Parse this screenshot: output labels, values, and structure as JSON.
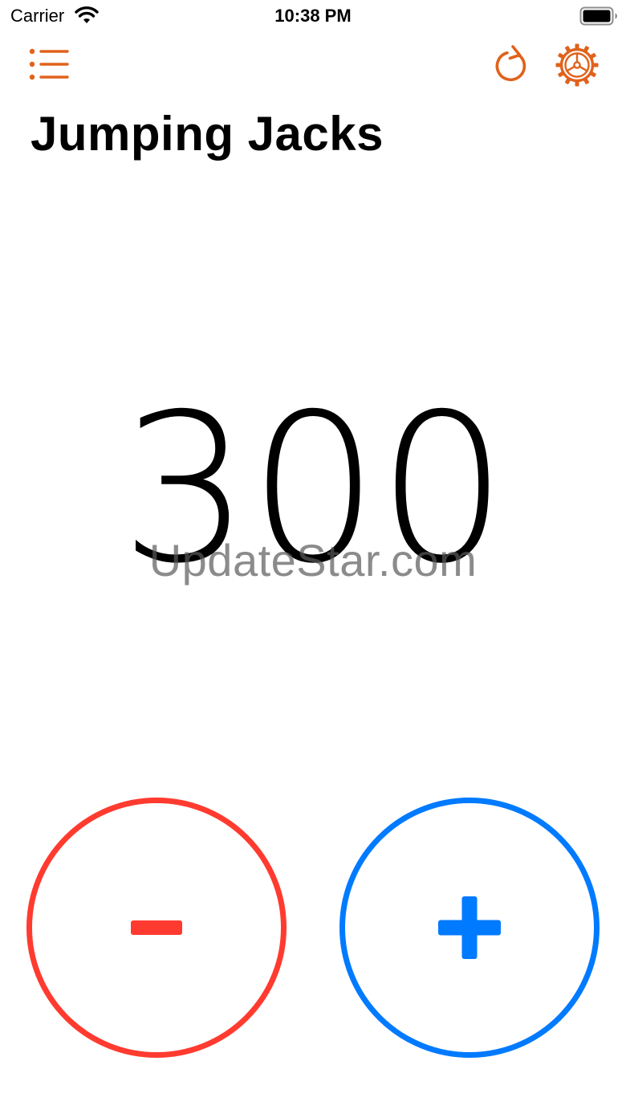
{
  "status_bar": {
    "carrier": "Carrier",
    "time": "10:38 PM",
    "icons": [
      "wifi-icon",
      "battery-icon"
    ]
  },
  "toolbar": {
    "icons": [
      "list-icon",
      "reset-icon",
      "settings-gear-icon"
    ],
    "accent_color": "#e0621c"
  },
  "counter": {
    "title": "Jumping Jacks",
    "value": "300"
  },
  "watermark": {
    "text": "UpdateStar.com"
  },
  "controls": {
    "decrement_icon": "minus-icon",
    "decrement_color": "#ff3b30",
    "increment_icon": "plus-icon",
    "increment_color": "#007aff"
  }
}
